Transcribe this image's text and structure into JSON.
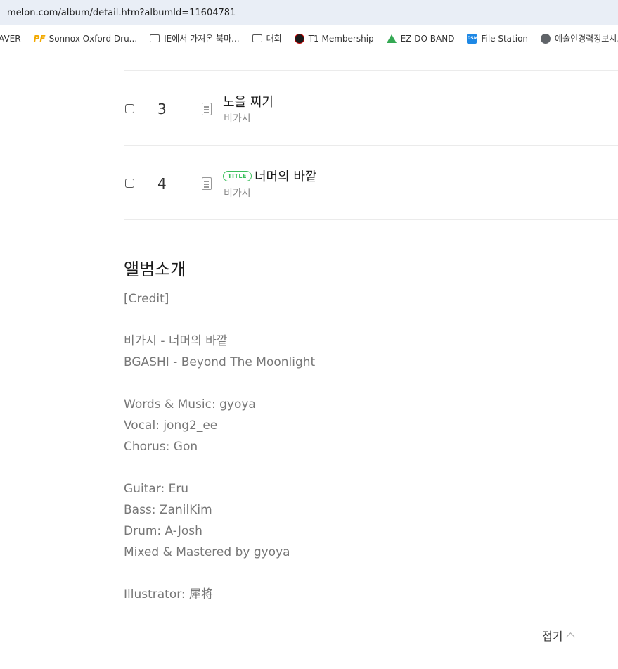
{
  "browser": {
    "url": "melon.com/album/detail.htm?albumId=11604781",
    "bookmarks": [
      {
        "label": "AVER",
        "icon": "none"
      },
      {
        "label": "Sonnox Oxford Dru...",
        "icon": "pf-icon"
      },
      {
        "label": "IE에서 가져온 북마...",
        "icon": "folder-icon"
      },
      {
        "label": "대회",
        "icon": "folder-icon"
      },
      {
        "label": "T1 Membership",
        "icon": "t1-icon"
      },
      {
        "label": "EZ DO BAND",
        "icon": "google-drive-icon"
      },
      {
        "label": "File Station",
        "icon": "dsm-icon"
      },
      {
        "label": "예술인경력정보시...",
        "icon": "globe-icon"
      }
    ]
  },
  "tracks": [
    {
      "number": "3",
      "title": "노을 찌기",
      "artist": "비가시",
      "is_title": false
    },
    {
      "number": "4",
      "title": "너머의 바깥",
      "artist": "비가시",
      "is_title": true,
      "badge": "TITLE"
    }
  ],
  "album_intro": {
    "heading": "앨범소개",
    "lines": [
      "[Credit]",
      "",
      "비가시 - 너머의 바깥",
      "BGASHI - Beyond The Moonlight",
      "",
      "Words & Music: gyoya",
      "Vocal: jong2_ee",
      "Chorus: Gon",
      "",
      "Guitar: Eru",
      "Bass: ZanilKim",
      "Drum: A-Josh",
      "Mixed & Mastered by gyoya",
      "",
      "Illustrator: 犀将"
    ],
    "collapse_label": "접기"
  },
  "colors": {
    "title_badge": "#3bbf5c",
    "text_muted": "#777777"
  }
}
